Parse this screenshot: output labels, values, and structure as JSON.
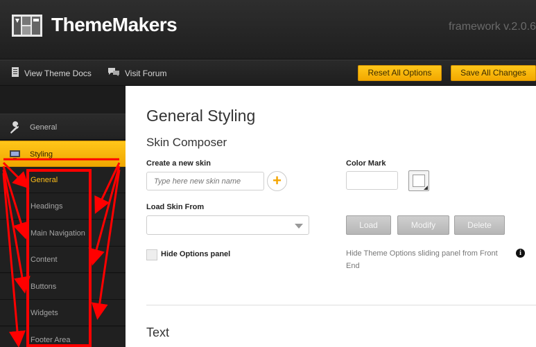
{
  "header": {
    "brand": "ThemeMakers",
    "version": "framework v.2.0.6"
  },
  "toolbar": {
    "docs_label": "View Theme Docs",
    "forum_label": "Visit Forum",
    "reset_label": "Reset All Options",
    "save_label": "Save All Changes"
  },
  "sidebar": {
    "items": [
      {
        "label": "General",
        "icon": "wrench-icon",
        "active": false
      },
      {
        "label": "Styling",
        "icon": "monitor-icon",
        "active": true
      }
    ],
    "subitems": [
      {
        "label": "General",
        "active": true
      },
      {
        "label": "Headings",
        "active": false
      },
      {
        "label": "Main Navigation",
        "active": false
      },
      {
        "label": "Content",
        "active": false
      },
      {
        "label": "Buttons",
        "active": false
      },
      {
        "label": "Widgets",
        "active": false
      },
      {
        "label": "Footer Area",
        "active": false
      }
    ]
  },
  "main": {
    "title": "General Styling",
    "section_title": "Skin Composer",
    "create_skin_label": "Create a new skin",
    "create_skin_placeholder": "Type here new skin name",
    "color_mark_label": "Color Mark",
    "load_skin_label": "Load Skin From",
    "load_button": "Load",
    "modify_button": "Modify",
    "delete_button": "Delete",
    "hide_options_label": "Hide Options panel",
    "hide_options_help": "Hide Theme Options sliding panel from Front End",
    "info_glyph": "i",
    "next_section_title": "Text"
  },
  "colors": {
    "accent": "#f5b400",
    "annotation": "#ff0000",
    "header_bg": "#262626"
  }
}
